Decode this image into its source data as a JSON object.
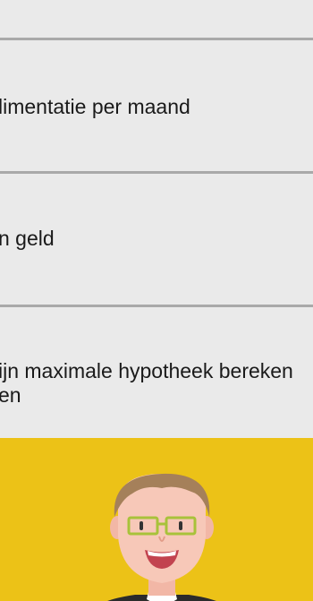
{
  "menu": {
    "items": [
      {
        "label": "limentatie per maand"
      },
      {
        "label": "n geld"
      },
      {
        "label": "ijn maximale hypotheek bereken\nen"
      }
    ]
  },
  "banner": {
    "background": "#ecc217",
    "avatar_icon": "advisor-avatar-icon"
  }
}
